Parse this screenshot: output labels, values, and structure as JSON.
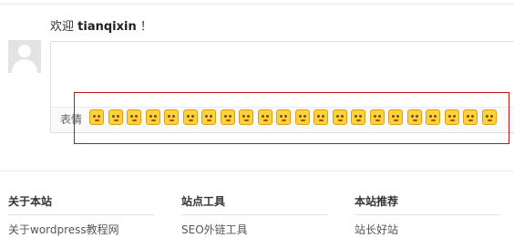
{
  "comment": {
    "welcome_prefix": "欢迎",
    "username": "tianqixin",
    "welcome_suffix": "！",
    "toolbar_label": "表情",
    "emoji_icons": [
      "blush-face-icon",
      "heart-eyes-face-icon",
      "smile-face-icon",
      "grin-face-icon",
      "shy-face-icon",
      "kiss-face-icon",
      "surprised-face-icon",
      "dizzy-face-icon",
      "sunglasses-face-icon",
      "tongue-face-icon",
      "angry-face-icon",
      "laugh-face-icon",
      "shocked-face-icon",
      "sweat-face-icon",
      "grimace-face-icon",
      "house-icon",
      "neutral-face-icon",
      "happy-face-icon",
      "blank-face-icon",
      "cross-eyed-face-icon",
      "wink-face-icon",
      "meh-face-icon"
    ]
  },
  "footer": {
    "columns": [
      {
        "title": "关于本站",
        "link": "关于wordpress教程网"
      },
      {
        "title": "站点工具",
        "link": "SEO外链工具"
      },
      {
        "title": "本站推荐",
        "link": "站长好站"
      }
    ]
  },
  "colors": {
    "highlight_box": "#c0131a",
    "emoji_fill": "#fcd33a",
    "emoji_border": "#e29c14"
  }
}
